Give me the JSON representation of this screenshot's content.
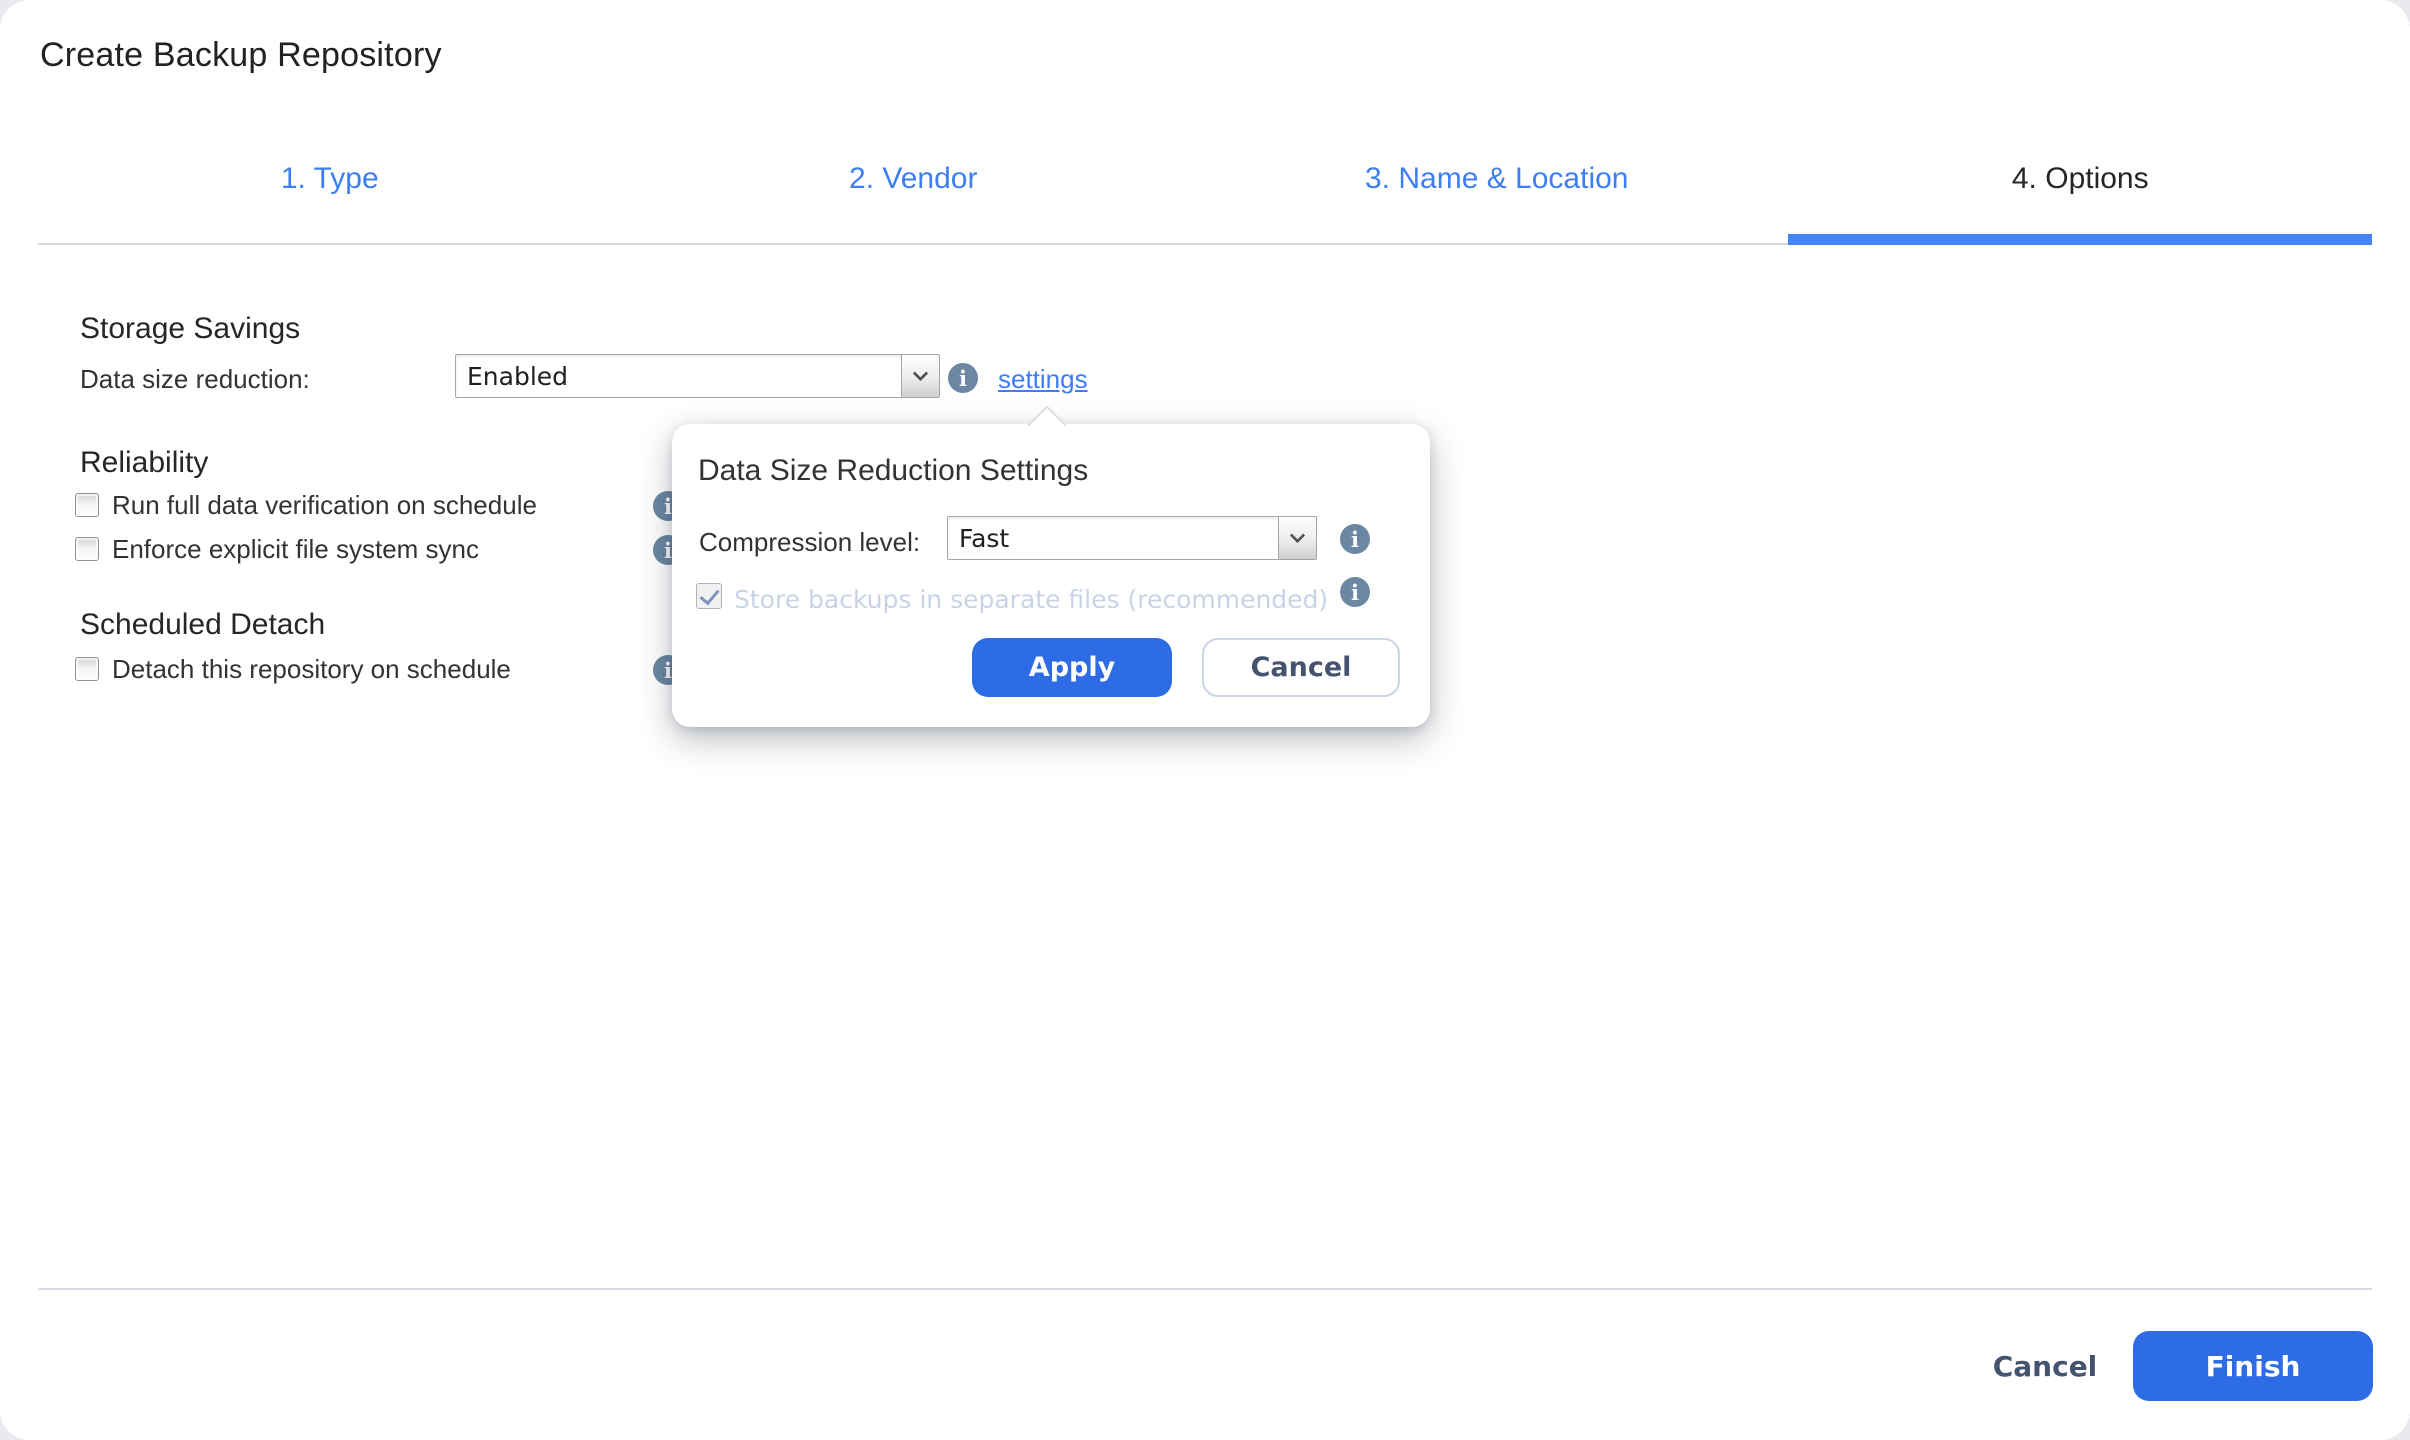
{
  "window_title": "Create Backup Repository",
  "tabs": [
    {
      "label": "1. Type",
      "state": "completed"
    },
    {
      "label": "2. Vendor",
      "state": "completed"
    },
    {
      "label": "3. Name & Location",
      "state": "completed"
    },
    {
      "label": "4. Options",
      "state": "active"
    }
  ],
  "storage_savings": {
    "heading": "Storage Savings",
    "row_label": "Data size reduction:",
    "select_value": "Enabled",
    "settings_link_label": "settings"
  },
  "reliability": {
    "heading": "Reliability",
    "checkboxes": [
      {
        "label": "Run full data verification on schedule",
        "checked": false
      },
      {
        "label": "Enforce explicit file system sync",
        "checked": false
      }
    ]
  },
  "scheduled_detach": {
    "heading": "Scheduled Detach",
    "checkboxes": [
      {
        "label": "Detach this repository on schedule",
        "checked": false
      }
    ]
  },
  "popover": {
    "title": "Data Size Reduction Settings",
    "compression_label": "Compression level:",
    "compression_value": "Fast",
    "store_checkbox": {
      "label": "Store backups in separate files (recommended)",
      "checked": true,
      "disabled": true
    },
    "apply_label": "Apply",
    "cancel_label": "Cancel"
  },
  "footer": {
    "cancel_label": "Cancel",
    "finish_label": "Finish"
  },
  "icons": {
    "info": "info-icon",
    "dropdown": "chevron-down-icon",
    "popover_pointer": "popover-arrow"
  },
  "colors": {
    "accent_blue": "#2D6CE5",
    "tab_blue": "#3D7FF2",
    "active_tab_bar": "#4285F4",
    "link_blue": "#3D7FF2",
    "info_icon": "#6C87A3",
    "disabled_text": "#C9D3E5"
  }
}
